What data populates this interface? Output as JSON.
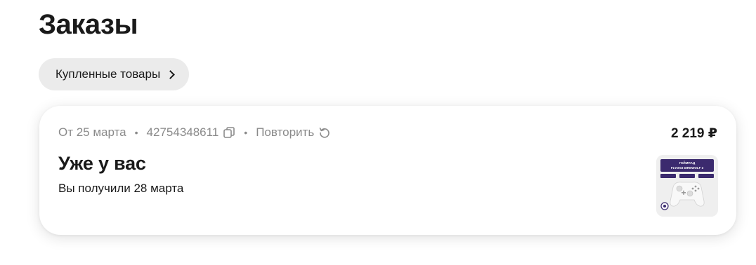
{
  "page": {
    "title": "Заказы"
  },
  "purchased_link": {
    "label": "Купленные товары"
  },
  "order": {
    "date": "От 25 марта",
    "number": "42754348611",
    "repeat_label": "Повторить",
    "price": "2 219 ₽",
    "status": "Уже у вас",
    "received": "Вы получили 28 марта",
    "thumbnail_text": "ГЕЙМПАД FLYDIGI DIREWOLF 3"
  },
  "icons": {
    "copy": "copy-icon",
    "repeat": "repeat-icon",
    "chevron": "chevron-right-icon"
  },
  "colors": {
    "chip_bg": "#ebebeb",
    "muted_text": "#8a8a8a",
    "thumb_purple": "#3b2a6e"
  }
}
